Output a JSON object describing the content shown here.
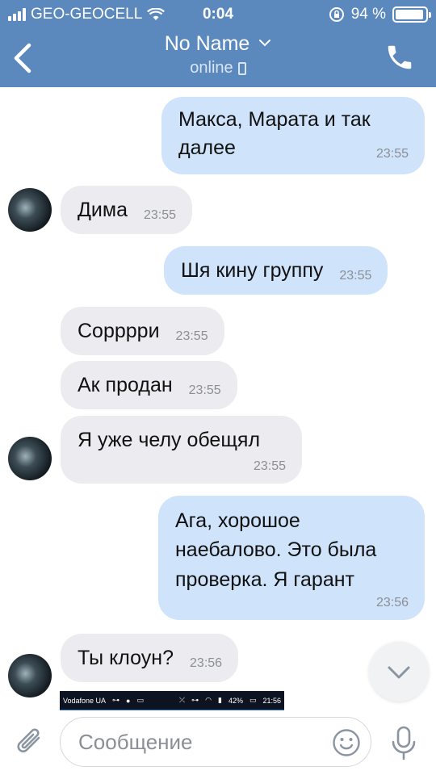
{
  "status_bar": {
    "carrier": "GEO-GEOCELL",
    "time": "0:04",
    "battery_percent": "94 %",
    "battery_level": 0.94
  },
  "header": {
    "title": "No Name",
    "title_chevron": "⌄",
    "subtitle": "online",
    "back_icon": "chevron-left-icon",
    "call_icon": "phone-icon"
  },
  "messages": [
    {
      "direction": "out",
      "lines": [
        "Макса, Марата и так",
        "далее"
      ],
      "time": "23:55"
    },
    {
      "direction": "in",
      "text": "Дима",
      "time": "23:55",
      "avatar": true
    },
    {
      "direction": "out",
      "text": "Шя кину группу",
      "time": "23:55"
    },
    {
      "direction": "in",
      "text": "Сорррри",
      "time": "23:55"
    },
    {
      "direction": "in",
      "text": "Ак продан",
      "time": "23:55"
    },
    {
      "direction": "in",
      "text": "Я уже челу обещял",
      "time": "23:55",
      "avatar": true
    },
    {
      "direction": "out",
      "lines": [
        "Ага, хорошое",
        "наебалово. Это была",
        "проверка. Я гарант"
      ],
      "time": "23:56"
    },
    {
      "direction": "in",
      "text": "Ты клоун?",
      "time": "23:56",
      "avatar": true
    }
  ],
  "embedded_screenshot": {
    "carrier": "Vodafone UA",
    "battery": "42%",
    "time": "21:56"
  },
  "input": {
    "placeholder": "Сообщение"
  },
  "colors": {
    "header": "#5b88bd",
    "outgoing_bubble": "#cfe3fb",
    "incoming_bubble": "#ececf0"
  }
}
